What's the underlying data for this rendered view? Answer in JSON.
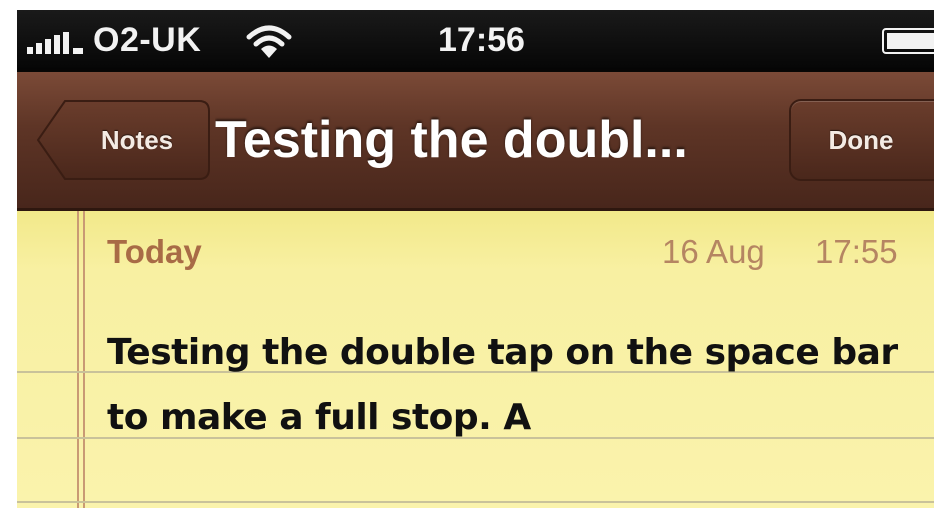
{
  "status_bar": {
    "signal_icon": "signal-bars-icon",
    "carrier": "O2-UK",
    "wifi_icon": "wifi-icon",
    "time": "17:56",
    "battery_icon": "battery-icon"
  },
  "nav_bar": {
    "back_label": "Notes",
    "title": "Testing the doubl...",
    "done_label": "Done"
  },
  "note": {
    "day_label": "Today",
    "date": "16 Aug",
    "time": "17:55",
    "lines": [
      "Testing the double tap on the space bar",
      "to make a full stop. A"
    ]
  },
  "colors": {
    "nav_bar": "#5e3526",
    "paper": "#f8f0a2",
    "day_label": "#a86b46",
    "rule_lines": "#c9c29a",
    "margin_line": "#c99a74"
  }
}
